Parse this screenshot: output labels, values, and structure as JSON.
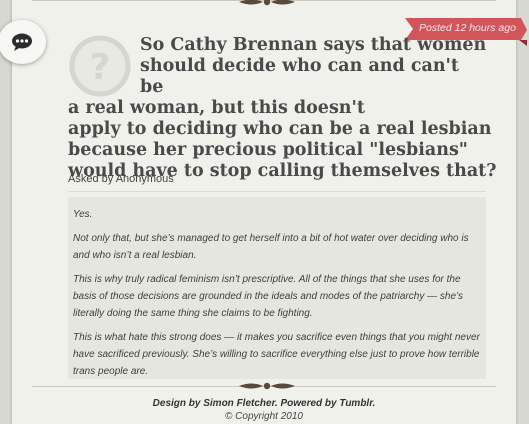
{
  "post": {
    "timestamp": "Posted 12 hours ago",
    "question_lines": [
      "So Cathy Brennan says that women",
      "should decide who can and can't be",
      "a real woman, but this doesn't",
      "apply to deciding who can be a real lesbian",
      "because her precious political \"lesbians\"",
      "would have to stop calling themselves that?"
    ],
    "asked_by": "Asked by Anonymous",
    "answer_paragraphs": [
      "Yes.",
      "Not only that, but she’s managed to get herself into a bit of hot water over deciding who is and who isn’t a real lesbian.",
      "This is why truly radical feminism isn’t prescriptive.  All of the things that she uses for the basis of those decisions are grounded in the ideals and modes of the patriarchy — she’s literally doing the same thing she claims to be fighting.",
      "This is what hate this strong does — it makes you sacrifice even things that you might never have sacrificed previously. She’s willing to sacrifice everything else just to prove how terrible trans people are."
    ]
  },
  "footer": {
    "design_prefix": "Design by ",
    "designer": "Simon Fletcher",
    "powered_prefix": ". Powered by ",
    "platform": "Tumblr",
    "suffix": ".",
    "copyright": "© Copyright 2010"
  },
  "icons": {
    "comment": "speech-bubble-icon",
    "avatar": "anonymous-question-mark-icon",
    "ornament": "flourish-ornament"
  },
  "colors": {
    "ribbon": "#d2555c",
    "background": "#f1f1ec",
    "answer_box": "#e6e6e1",
    "question_text": "#4a4a4a"
  }
}
